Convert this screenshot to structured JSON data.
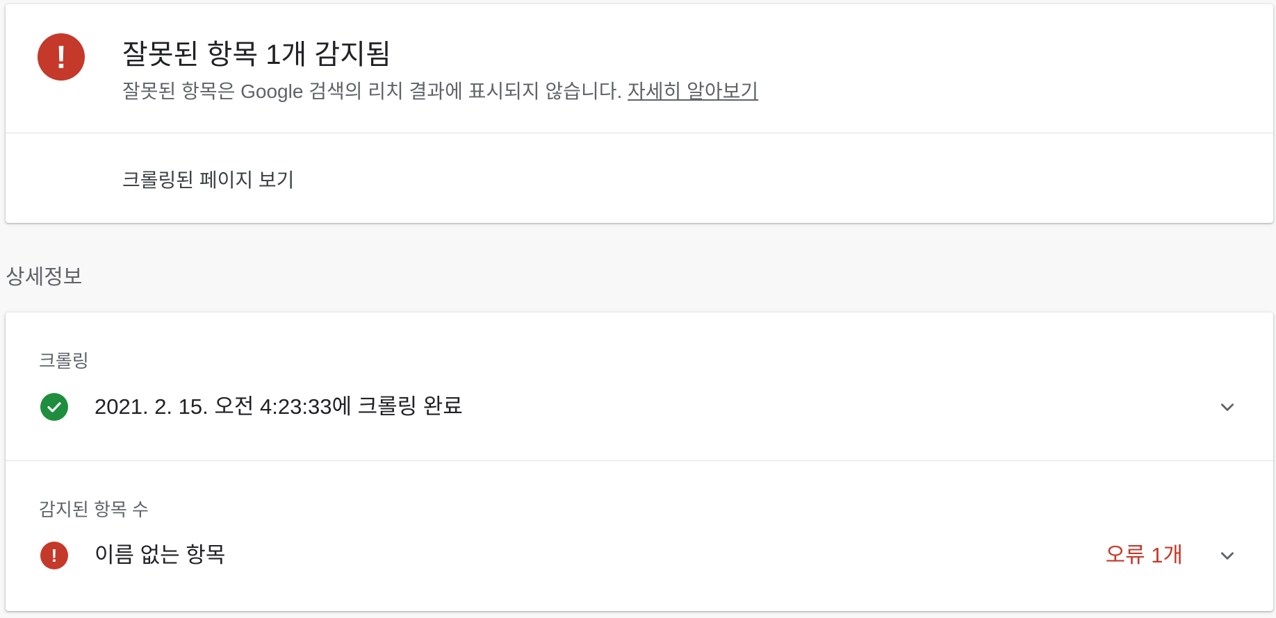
{
  "summary": {
    "title": "잘못된 항목 1개 감지됨",
    "description": "잘못된 항목은 Google 검색의 리치 결과에 표시되지 않습니다.",
    "learn_more": "자세히 알아보기",
    "view_crawled_page": "크롤링된 페이지 보기",
    "error_icon_glyph": "!"
  },
  "details": {
    "section_label": "상세정보",
    "crawl": {
      "label": "크롤링",
      "status_text": "2021. 2. 15. 오전 4:23:33에 크롤링 완료",
      "icon": "check-circle-icon"
    },
    "detected_items": {
      "label": "감지된 항목 수",
      "item_name": "이름 없는 항목",
      "error_count": "오류 1개",
      "icon_glyph": "!"
    }
  },
  "colors": {
    "error": "#c5392a",
    "success": "#1e8e3e",
    "secondary_text": "#5f6368",
    "background": "#f8f8f8"
  }
}
